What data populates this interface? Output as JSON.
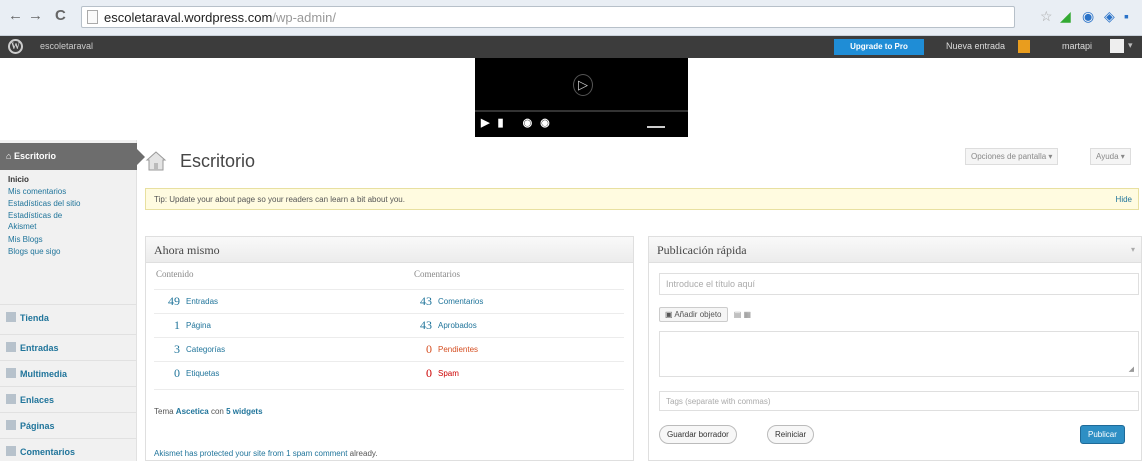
{
  "browser": {
    "back": "←",
    "forward": "→",
    "reload": "C",
    "url_host": "escoletaraval.wordpress.com",
    "url_path": "/wp-admin/"
  },
  "adminbar": {
    "logo": "W",
    "site_name": "escoletaraval",
    "upgrade": "Upgrade to Pro",
    "new_post": "Nueva entrada",
    "user": "martapi"
  },
  "sidebar": {
    "active": "Escritorio",
    "subitems": [
      {
        "label": "Inicio",
        "current": true
      },
      {
        "label": "Mis comentarios"
      },
      {
        "label": "Estadísticas del sitio"
      },
      {
        "label": "Estadísticas de"
      },
      {
        "label": "Akismet"
      },
      {
        "label": "Mis Blogs"
      },
      {
        "label": "Blogs que sigo"
      }
    ],
    "items": [
      {
        "label": "Tienda",
        "icon": "store-icon"
      },
      {
        "label": "Entradas",
        "icon": "pin-icon"
      },
      {
        "label": "Multimedia",
        "icon": "media-icon"
      },
      {
        "label": "Enlaces",
        "icon": "link-icon"
      },
      {
        "label": "Páginas",
        "icon": "page-icon"
      },
      {
        "label": "Comentarios",
        "icon": "comment-icon"
      }
    ]
  },
  "main": {
    "title": "Escritorio",
    "screen_options": "Opciones de pantalla",
    "help": "Ayuda",
    "tip": "Tip: Update your about page so your readers can learn a bit about you.",
    "hide": "Hide"
  },
  "right_now": {
    "title": "Ahora mismo",
    "content_header": "Contenido",
    "comments_header": "Comentarios",
    "content": [
      {
        "num": "49",
        "label": "Entradas"
      },
      {
        "num": "1",
        "label": "Página"
      },
      {
        "num": "3",
        "label": "Categorías"
      },
      {
        "num": "0",
        "label": "Etiquetas"
      }
    ],
    "comments": [
      {
        "num": "43",
        "label": "Comentarios"
      },
      {
        "num": "43",
        "label": "Aprobados"
      },
      {
        "num": "0",
        "label": "Pendientes"
      },
      {
        "num": "0",
        "label": "Spam"
      }
    ],
    "theme_prefix": "Tema",
    "theme_name": "Ascetica",
    "theme_mid": "con",
    "widgets": "5 widgets",
    "akismet_prefix": "Akismet has protected your site from",
    "akismet_link": "1 spam comment",
    "akismet_suffix": "already."
  },
  "quick_press": {
    "title": "Publicación rápida",
    "title_placeholder": "Introduce el título aquí",
    "add_media": "Añadir objeto",
    "tags_placeholder": "Tags (separate with commas)",
    "save_draft": "Guardar borrador",
    "reset": "Reiniciar",
    "publish": "Publicar"
  },
  "colors": {
    "link": "#21759b",
    "pending": "#d54e21",
    "spam": "#cc0000",
    "upgrade": "#1f8dd6",
    "publish": "#2e8fc4"
  }
}
